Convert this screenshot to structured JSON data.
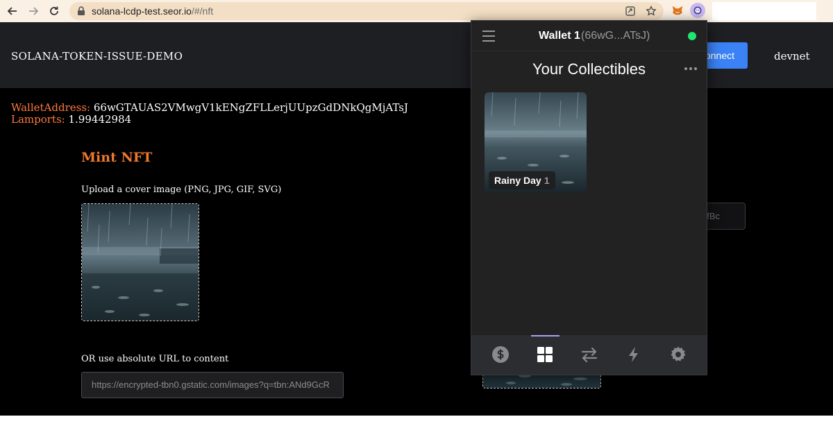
{
  "browser": {
    "url_host": "solana-lcdp-test.seor.io",
    "url_path": "/#/nft"
  },
  "app": {
    "title": "SOLANA-TOKEN-ISSUE-DEMO",
    "connect_label": "Connect",
    "network": "devnet",
    "wallet_address_label": "WalletAddress:",
    "wallet_address_value": "66wGTAUAS2VMwgV1kENgZFLLerjUUpzGdDNkQgMjATsJ",
    "lamports_label": "Lamports:",
    "lamports_value": "1.99442984",
    "mint_title": "Mint NFT",
    "upload_label": "Upload a cover image (PNG, JPG, GIF, SVG)",
    "url_label": "OR use absolute URL to content",
    "url_input_value": "https://encrypted-tbn0.gstatic.com/images?q=tbn:ANd9GcR",
    "right_input_value": "fBc"
  },
  "wallet": {
    "name": "Wallet 1",
    "short_address": "(66wG...ATsJ)",
    "status_color": "#21e56f",
    "section_title": "Your Collectibles",
    "collectibles": [
      {
        "name": "Rainy Day",
        "count": "1"
      }
    ],
    "tabs": [
      {
        "name": "tokens",
        "icon": "dollar-icon"
      },
      {
        "name": "collectibles",
        "icon": "grid-icon",
        "active": true
      },
      {
        "name": "swap",
        "icon": "swap-arrows-icon"
      },
      {
        "name": "activity",
        "icon": "lightning-icon"
      },
      {
        "name": "settings",
        "icon": "gear-icon"
      }
    ],
    "accent_color": "#ab9ff2"
  }
}
